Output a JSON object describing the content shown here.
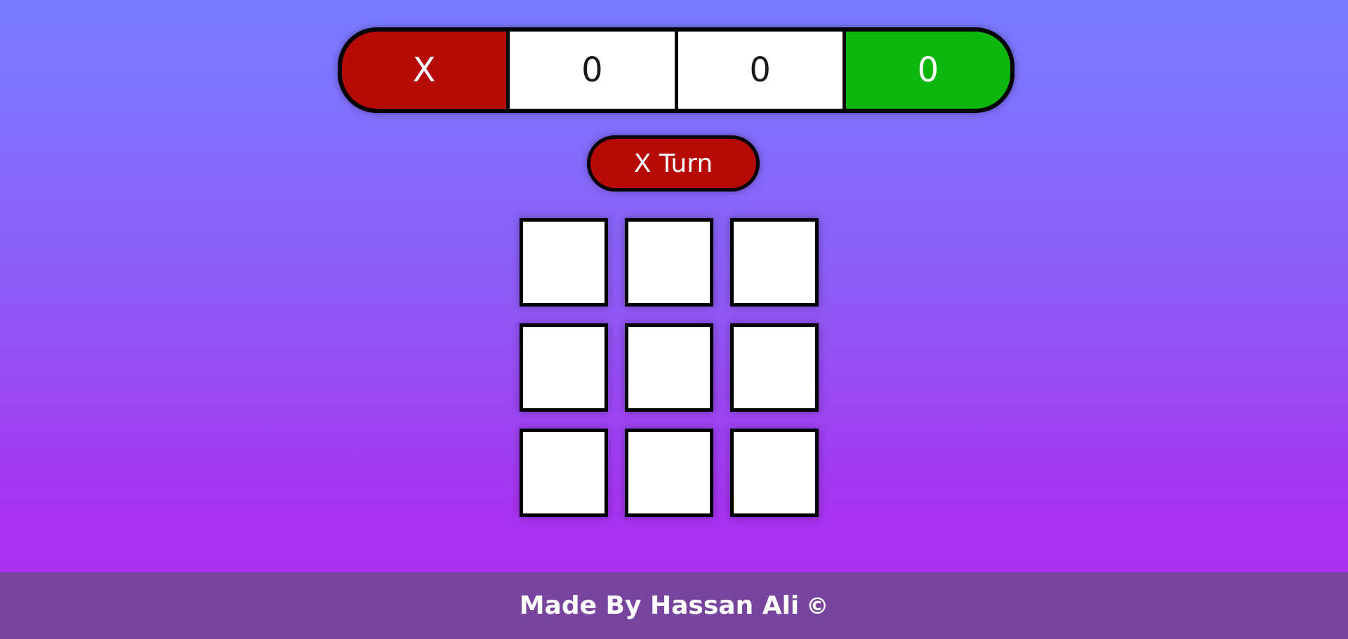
{
  "scoreboard": {
    "x_label": "X",
    "x_score": "0",
    "o_score": "0",
    "o_label": "0"
  },
  "turn": {
    "label": "X Turn"
  },
  "board": {
    "cells": [
      "",
      "",
      "",
      "",
      "",
      "",
      "",
      "",
      ""
    ]
  },
  "footer": {
    "text": "Made By Hassan Ali",
    "icon": "copyright-icon",
    "icon_glyph": "©"
  },
  "colors": {
    "x_accent": "#b50a06",
    "o_accent": "#0db70d",
    "footer_bg": "#77449e",
    "gradient_top": "#787cff",
    "gradient_bottom": "#a72ff0"
  }
}
